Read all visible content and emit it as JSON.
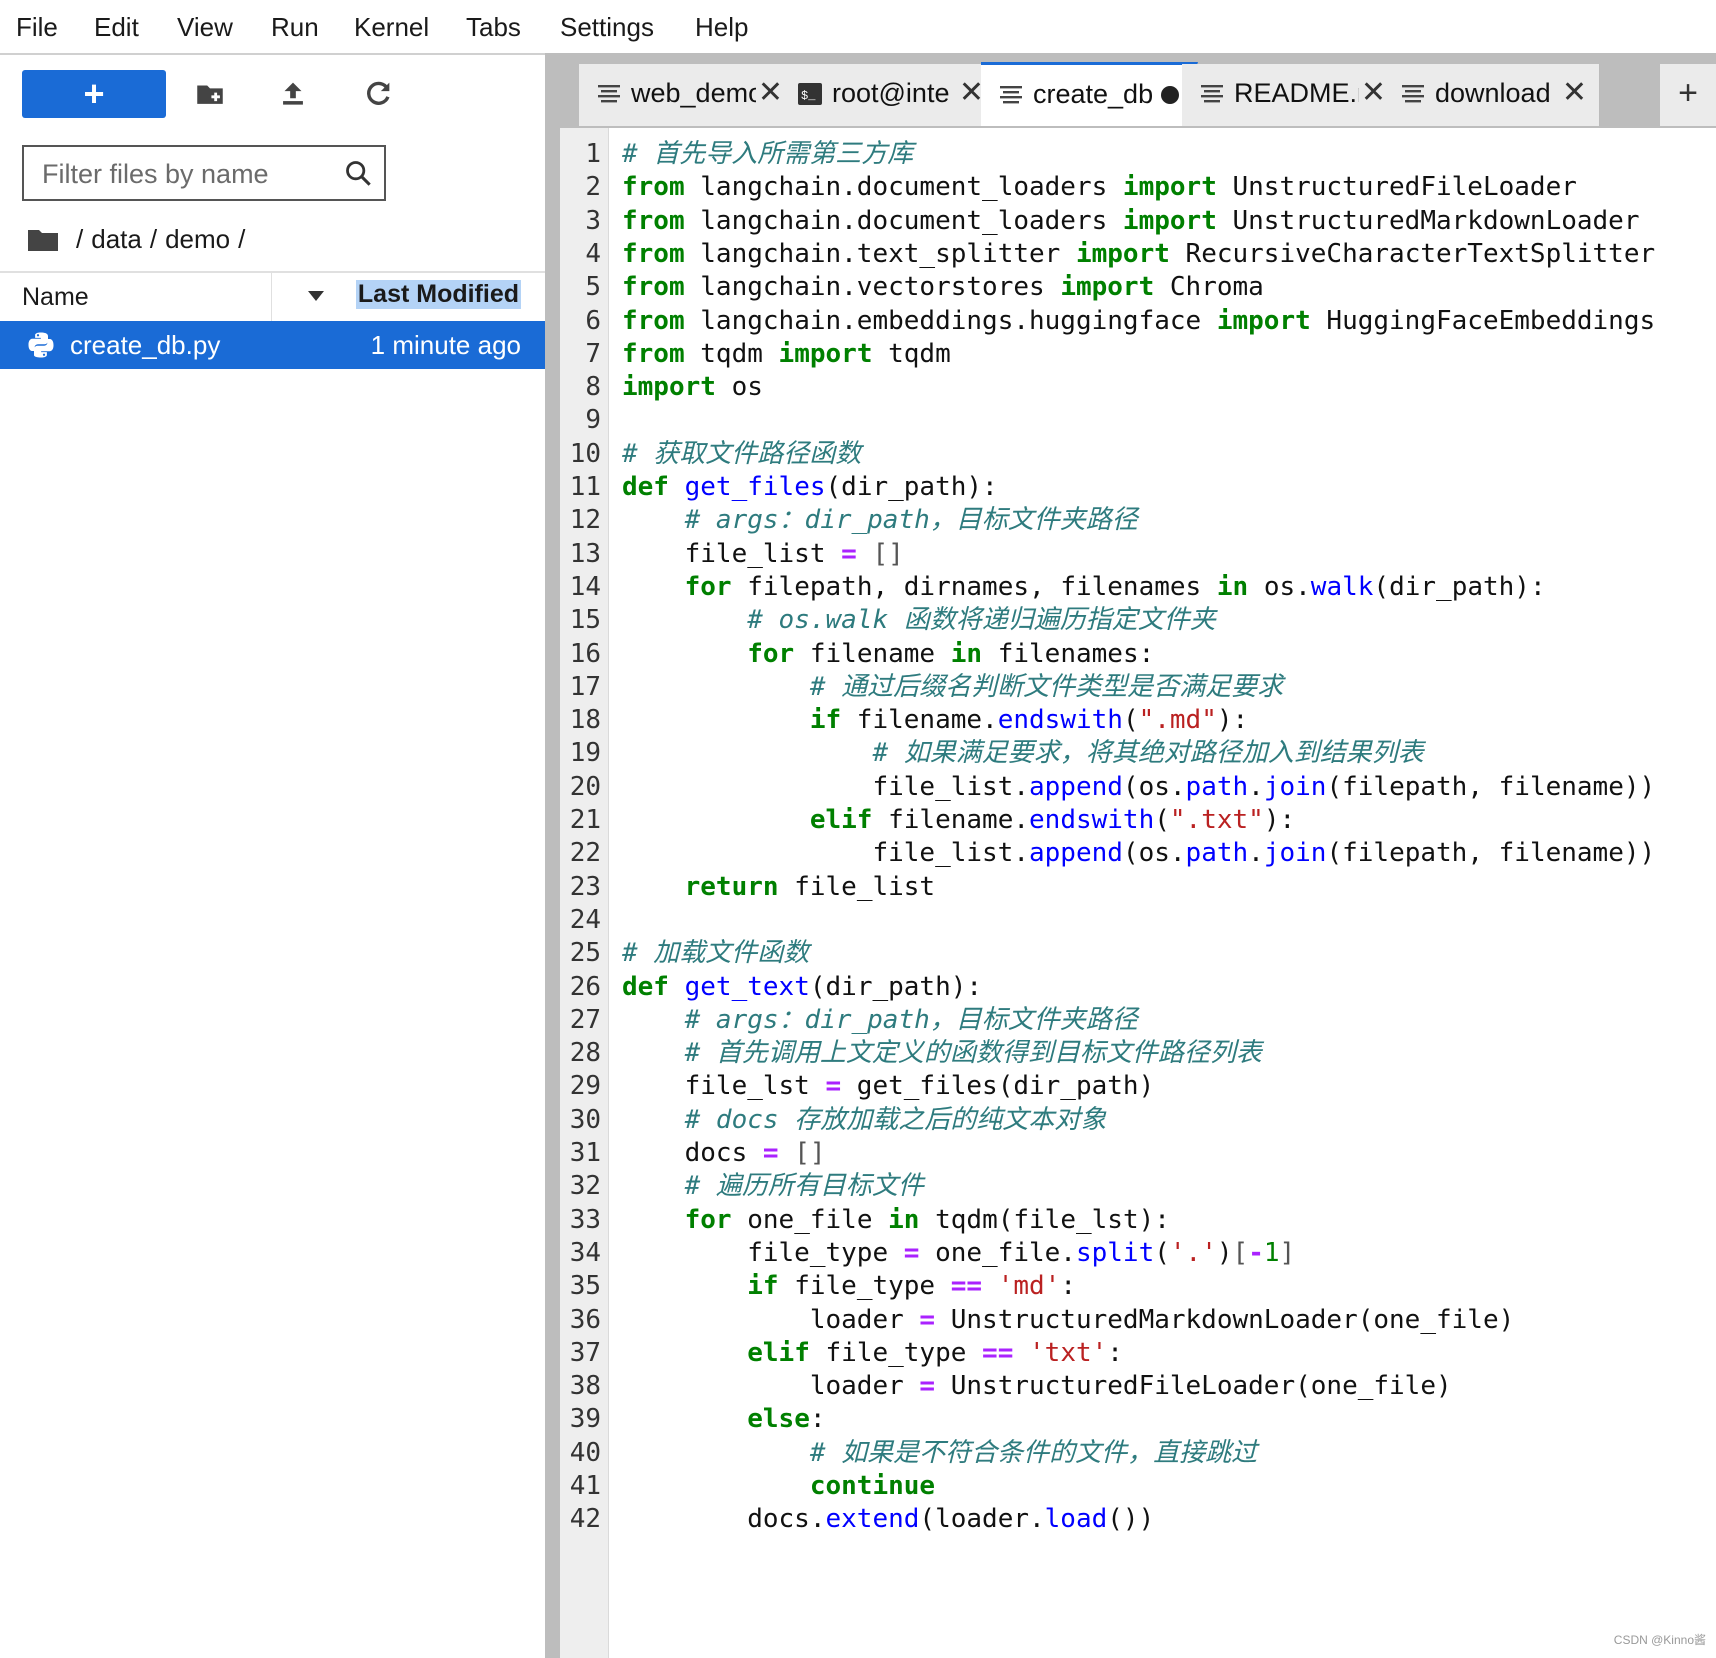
{
  "menu": [
    "File",
    "Edit",
    "View",
    "Run",
    "Kernel",
    "Tabs",
    "Settings",
    "Help"
  ],
  "filebrowser": {
    "new_label": "+",
    "filter_placeholder": "Filter files by name",
    "breadcrumb": [
      "data",
      "demo"
    ],
    "breadcrumb_sep": "/",
    "col_name": "Name",
    "col_modified": "Last Modified",
    "files": [
      {
        "name": "create_db.py",
        "modified": "1 minute ago"
      }
    ]
  },
  "tabs": [
    {
      "label": "web_demo",
      "icon": "text-file-icon",
      "state": "close"
    },
    {
      "label": "root@inte",
      "icon": "terminal-icon",
      "state": "close"
    },
    {
      "label": "create_db",
      "icon": "text-file-icon",
      "state": "dirty",
      "active": true
    },
    {
      "label": "README.md",
      "icon": "text-file-icon",
      "state": "close"
    },
    {
      "label": "download",
      "icon": "text-file-icon",
      "state": "close"
    }
  ],
  "tab_add": "+",
  "tab_close": "✕",
  "code_lines": [
    "# 首先导入所需第三方库",
    "from langchain.document_loaders import UnstructuredFileLoader",
    "from langchain.document_loaders import UnstructuredMarkdownLoader",
    "from langchain.text_splitter import RecursiveCharacterTextSplitter",
    "from langchain.vectorstores import Chroma",
    "from langchain.embeddings.huggingface import HuggingFaceEmbeddings",
    "from tqdm import tqdm",
    "import os",
    "",
    "# 获取文件路径函数",
    "def get_files(dir_path):",
    "    # args：dir_path，目标文件夹路径",
    "    file_list = []",
    "    for filepath, dirnames, filenames in os.walk(dir_path):",
    "        # os.walk 函数将递归遍历指定文件夹",
    "        for filename in filenames:",
    "            # 通过后缀名判断文件类型是否满足要求",
    "            if filename.endswith(\".md\"):",
    "                # 如果满足要求，将其绝对路径加入到结果列表",
    "                file_list.append(os.path.join(filepath, filename))",
    "            elif filename.endswith(\".txt\"):",
    "                file_list.append(os.path.join(filepath, filename))",
    "    return file_list",
    "",
    "# 加载文件函数",
    "def get_text(dir_path):",
    "    # args：dir_path，目标文件夹路径",
    "    # 首先调用上文定义的函数得到目标文件路径列表",
    "    file_lst = get_files(dir_path)",
    "    # docs 存放加载之后的纯文本对象",
    "    docs = []",
    "    # 遍历所有目标文件",
    "    for one_file in tqdm(file_lst):",
    "        file_type = one_file.split('.')[-1]",
    "        if file_type == 'md':",
    "            loader = UnstructuredMarkdownLoader(one_file)",
    "        elif file_type == 'txt':",
    "            loader = UnstructuredFileLoader(one_file)",
    "        else:",
    "            # 如果是不符合条件的文件，直接跳过",
    "            continue",
    "        docs.extend(loader.load())"
  ],
  "watermark": "CSDN @Kinno酱",
  "colors": {
    "accent": "#1a6bd6",
    "keyword": "#008000",
    "comment": "#2e7b7e",
    "string": "#ba2121",
    "function": "#0000ff",
    "operator": "#aa22ff"
  }
}
